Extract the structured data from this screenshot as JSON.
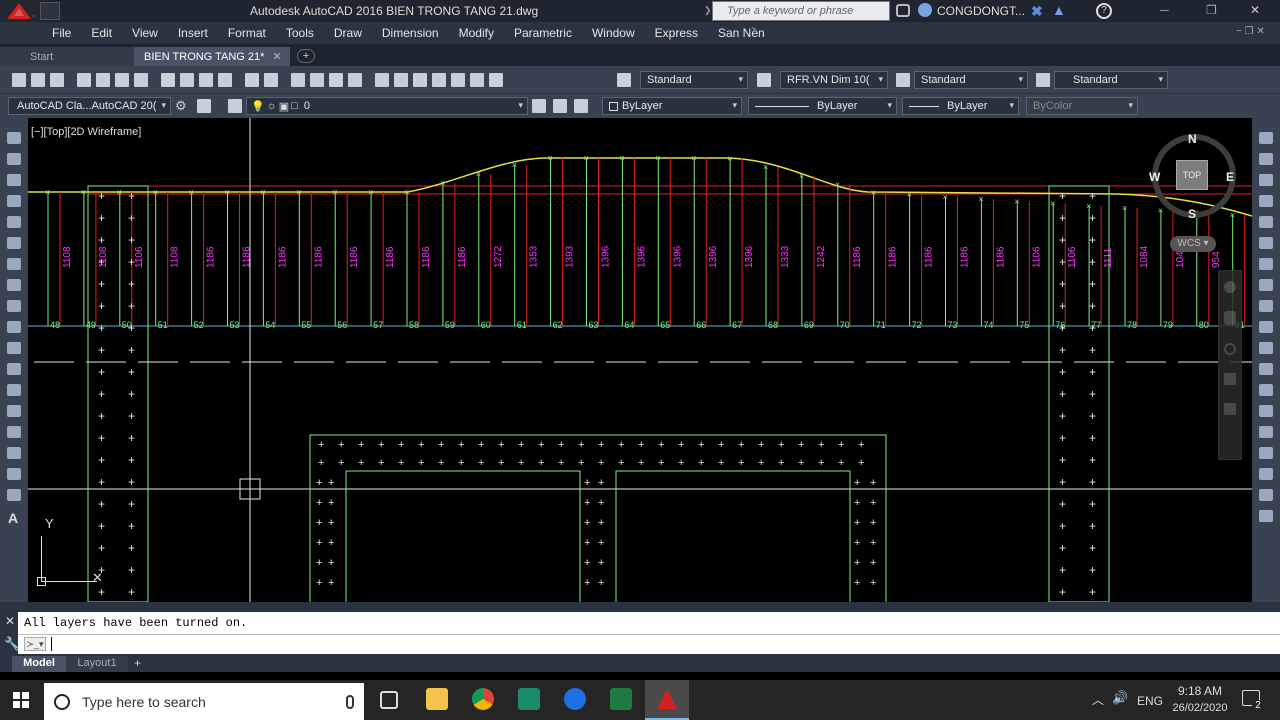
{
  "window": {
    "title": "Autodesk AutoCAD 2016    BIEN TRONG TANG 21.dwg",
    "search_placeholder": "Type a keyword or phrase",
    "user": "CONGDONGT...",
    "minimize": "─",
    "restore": "❐",
    "close": "✕"
  },
  "menu": [
    "File",
    "Edit",
    "View",
    "Insert",
    "Format",
    "Tools",
    "Draw",
    "Dimension",
    "Modify",
    "Parametric",
    "Window",
    "Express",
    "San Nền"
  ],
  "tabs": {
    "start": "Start",
    "drawing": "BIEN TRONG TANG 21*",
    "drawing_close": "✕",
    "add": "+"
  },
  "toolbar": {
    "text_style": "Standard",
    "dim_style": "RFR.VN Dim 10(",
    "table_style": "Standard",
    "mleader_style": "Standard",
    "workspace": "AutoCAD Cla...AutoCAD 20(",
    "layer": "0",
    "color": "ByLayer",
    "linetype": "ByLayer",
    "lineweight": "ByLayer",
    "plotstyle": "ByColor"
  },
  "viewport": {
    "label": "[−][Top][2D Wireframe]",
    "compass": {
      "n": "N",
      "s": "S",
      "e": "E",
      "w": "W",
      "top": "TOP"
    },
    "wcs": "WCS",
    "ucs_y": "Y"
  },
  "drawing": {
    "elevations": [
      "1108",
      "1108",
      "1106",
      "1108",
      "1186",
      "1186",
      "1186",
      "1186",
      "1186",
      "1186",
      "1186",
      "1186",
      "1272",
      "1353",
      "1393",
      "1396",
      "1396",
      "1396",
      "1396",
      "1396",
      "1333",
      "1242",
      "1186",
      "1186",
      "1186",
      "1186",
      "1186",
      "1106",
      "1106",
      "1111",
      "1084",
      "1041",
      "954"
    ],
    "station_labels": [
      "48",
      "49",
      "50",
      "51",
      "52",
      "53",
      "54",
      "55",
      "56",
      "57",
      "58",
      "59",
      "60",
      "61",
      "62",
      "63",
      "64",
      "65",
      "66",
      "67",
      "68",
      "69",
      "70",
      "71",
      "72",
      "73",
      "74",
      "75",
      "76",
      "77",
      "78",
      "79",
      "80",
      "81"
    ]
  },
  "command": {
    "output": "All layers have been turned on.",
    "prompt": "≻_▾"
  },
  "layouts": {
    "model": "Model",
    "layout1": "Layout1",
    "add": "+"
  },
  "taskbar": {
    "search_placeholder": "Type here to search",
    "language": "ENG",
    "time": "9:18 AM",
    "date": "26/02/2020",
    "notifications": "2"
  }
}
